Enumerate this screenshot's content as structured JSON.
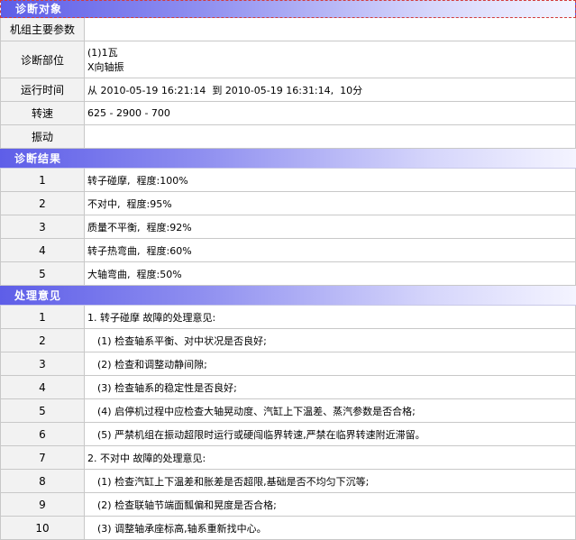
{
  "sections": {
    "object_title": "诊断对象",
    "result_title": "诊断结果",
    "opinion_title": "处理意见"
  },
  "object": {
    "rows": [
      {
        "label": "机组主要参数",
        "value": ""
      },
      {
        "label": "诊断部位",
        "value_line1": "(1)1瓦",
        "value_line2": "X向轴振"
      },
      {
        "label": "运行时间",
        "value": "从 2010-05-19 16:21:14  到 2010-05-19 16:31:14,  10分"
      },
      {
        "label": "转速",
        "value": "625 - 2900 - 700"
      },
      {
        "label": "振动",
        "value": ""
      }
    ]
  },
  "results": [
    {
      "index": "1",
      "text": "转子碰摩,  程度:100%"
    },
    {
      "index": "2",
      "text": "不对中,  程度:95%"
    },
    {
      "index": "3",
      "text": "质量不平衡,  程度:92%"
    },
    {
      "index": "4",
      "text": "转子热弯曲,  程度:60%"
    },
    {
      "index": "5",
      "text": "大轴弯曲,  程度:50%"
    }
  ],
  "opinions": [
    {
      "index": "1",
      "text": "1. 转子碰摩 故障的处理意见:",
      "indent": false
    },
    {
      "index": "2",
      "text": "(1) 检查轴系平衡、对中状况是否良好;",
      "indent": true
    },
    {
      "index": "3",
      "text": "(2) 检查和调整动静间隙;",
      "indent": true
    },
    {
      "index": "4",
      "text": "(3) 检查轴系的稳定性是否良好;",
      "indent": true
    },
    {
      "index": "5",
      "text": "(4) 启停机过程中应检查大轴晃动度、汽缸上下温差、蒸汽参数是否合格;",
      "indent": true
    },
    {
      "index": "6",
      "text": "(5) 严禁机组在振动超限时运行或硬闯临界转速,严禁在临界转速附近滞留。",
      "indent": true
    },
    {
      "index": "7",
      "text": "2. 不对中 故障的处理意见:",
      "indent": false
    },
    {
      "index": "8",
      "text": "(1) 检查汽缸上下温差和胀差是否超限,基础是否不均匀下沉等;",
      "indent": true
    },
    {
      "index": "9",
      "text": "(2) 检查联轴节端面瓢偏和晃度是否合格;",
      "indent": true
    },
    {
      "index": "10",
      "text": "(3) 调整轴承座标高,轴系重新找中心。",
      "indent": true
    }
  ]
}
